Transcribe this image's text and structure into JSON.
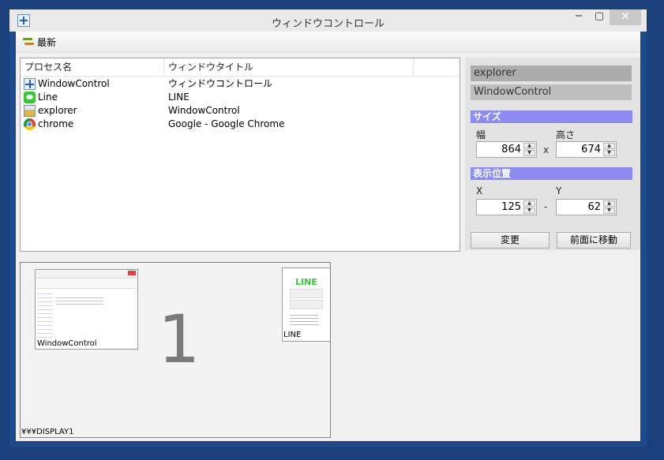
{
  "window": {
    "title": "ウィンドウコントロール",
    "minimize": "−",
    "maximize": "▢",
    "close": "✕"
  },
  "toolbar": {
    "refresh_label": "最新"
  },
  "list": {
    "columns": [
      "プロセス名",
      "ウィンドウタイトル"
    ],
    "rows": [
      {
        "process": "WindowControl",
        "title": "ウィンドウコントロール",
        "icon": "windowcontrol-icon"
      },
      {
        "process": "Line",
        "title": "LINE",
        "icon": "line-icon"
      },
      {
        "process": "explorer",
        "title": "WindowControl",
        "icon": "explorer-icon"
      },
      {
        "process": "chrome",
        "title": "Google - Google Chrome",
        "icon": "chrome-icon"
      }
    ]
  },
  "panel": {
    "selected_process": "explorer",
    "selected_title": "WindowControl",
    "size_header": "サイズ",
    "width_label": "幅",
    "height_label": "高さ",
    "width_value": "864",
    "height_value": "674",
    "size_sep": "x",
    "position_header": "表示位置",
    "x_label": "X",
    "y_label": "Y",
    "x_value": "125",
    "y_value": "62",
    "pos_sep": "-",
    "apply_label": "変更",
    "front_label": "前面に移動"
  },
  "preview": {
    "display_number": "1",
    "display_name": "¥¥¥DISPLAY1",
    "windows": [
      {
        "label": "WindowControl"
      },
      {
        "label": "LINE",
        "content": "LINE"
      }
    ]
  },
  "colors": {
    "frame": "#1e4a8a",
    "section_header": "#8b8bf0",
    "line_green": "#3ac23a"
  }
}
